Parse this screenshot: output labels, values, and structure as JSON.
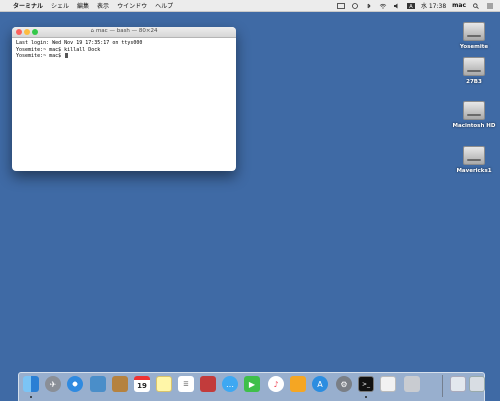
{
  "menubar": {
    "app_name": "ターミナル",
    "items": [
      "シェル",
      "編集",
      "表示",
      "ウインドウ",
      "ヘルプ"
    ],
    "clock": "水 17:38",
    "user": "mac"
  },
  "desktop": {
    "drives": [
      "Yosemite",
      "27B3",
      "Macintosh HD",
      "Mavericks1"
    ]
  },
  "terminal": {
    "title": "mac — bash — 80×24",
    "lines": [
      "Last login: Wed Nov 19 17:35:17 on ttys000",
      "Yosemite:~ mac$ killall Dock",
      "Yosemite:~ mac$ "
    ]
  },
  "dock": {
    "apps": [
      "finder",
      "launchpad",
      "safari",
      "preview",
      "contacts",
      "calendar",
      "notes",
      "reminders",
      "photo-booth",
      "messages",
      "facetime",
      "music",
      "ibooks",
      "app-store",
      "system-preferences",
      "terminal",
      "text-edit",
      "disk-utility",
      "downloads",
      "trash"
    ]
  },
  "colors": {
    "desktop": "#3f6aa5",
    "close": "#fc615d",
    "minimize": "#fdbc40",
    "zoom": "#34c84a"
  }
}
